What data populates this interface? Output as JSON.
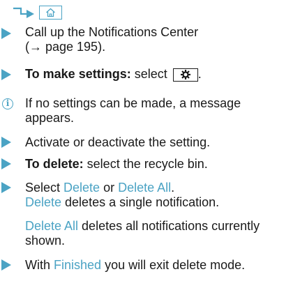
{
  "header": {
    "icons": [
      "right-turn-arrow-icon",
      "home-icon"
    ]
  },
  "steps": [
    {
      "line1": "Call up the Notifications Center",
      "line2": "(→ page 195)."
    },
    {
      "bold": "To make settings:",
      "text": " select",
      "trail": "."
    },
    {
      "line1": "If no settings can be made, a message",
      "line2": "appears."
    },
    {
      "text": "Activate or deactivate the setting."
    },
    {
      "bold": "To delete:",
      "text": " select the recycle bin."
    },
    {
      "pre": "Select ",
      "link1": "Delete",
      "mid": " or ",
      "link2": "Delete All",
      "post": ".",
      "line2_link": "Delete",
      "line2_text": " deletes a single notification."
    },
    {
      "link": "Delete All",
      "text": " deletes all notifications currently",
      "line2": "shown."
    },
    {
      "pre": "With ",
      "link": "Finished",
      "post": " you will exit delete mode."
    }
  ],
  "colors": {
    "accent": "#4ba3c4",
    "text": "#1a1a1a"
  }
}
